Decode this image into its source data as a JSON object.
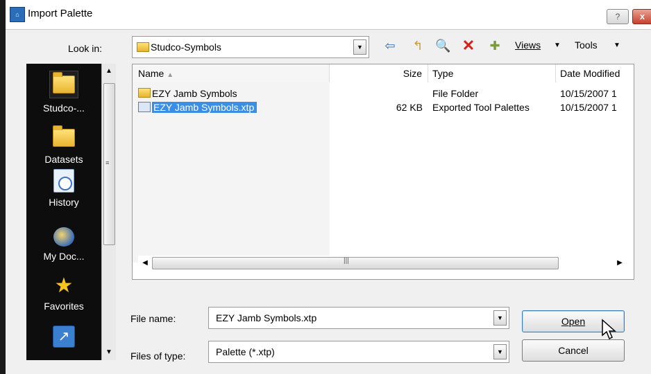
{
  "window": {
    "title": "Import Palette",
    "help_label": "?",
    "close_label": "x"
  },
  "lookin": {
    "label": "Look in:",
    "value": "Studco-Symbols"
  },
  "toolbar": {
    "views_label": "Views",
    "tools_label": "Tools"
  },
  "places": [
    {
      "label": "Studco-...",
      "icon": "folder-icon"
    },
    {
      "label": "Datasets",
      "icon": "folder-icon"
    },
    {
      "label": "History",
      "icon": "history-icon"
    },
    {
      "label": "My Doc...",
      "icon": "my-documents-icon"
    },
    {
      "label": "Favorites",
      "icon": "favorites-star-icon"
    },
    {
      "label": "",
      "icon": "ftp-icon"
    }
  ],
  "filelist": {
    "columns": {
      "name": "Name",
      "size": "Size",
      "type": "Type",
      "date": "Date Modified"
    },
    "rows": [
      {
        "name": "EZY Jamb Symbols",
        "size": "",
        "type": "File Folder",
        "date": "10/15/2007 1",
        "icon": "folder-icon",
        "selected": false
      },
      {
        "name": "EZY Jamb Symbols.xtp",
        "size": "62 KB",
        "type": "Exported Tool Palettes",
        "date": "10/15/2007 1",
        "icon": "xtp-file-icon",
        "selected": true
      }
    ]
  },
  "filename": {
    "label": "File name:",
    "value": "EZY Jamb Symbols.xtp"
  },
  "filetype": {
    "label": "Files of type:",
    "value": "Palette (*.xtp)"
  },
  "buttons": {
    "open": "Open",
    "cancel": "Cancel"
  },
  "colors": {
    "selection": "#3a8ee6",
    "places_bg": "#0d0d0d",
    "close": "#c7412d"
  }
}
